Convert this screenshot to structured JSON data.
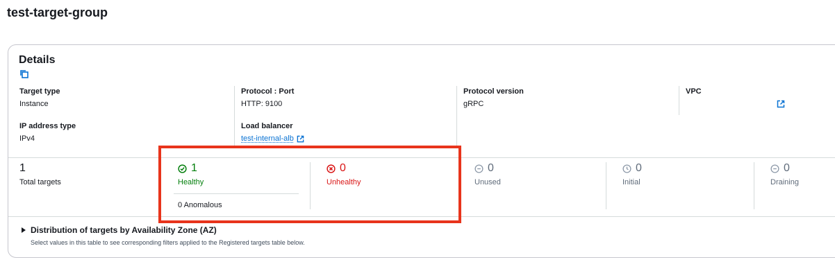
{
  "page": {
    "title": "test-target-group"
  },
  "details": {
    "title": "Details",
    "target_type": {
      "label": "Target type",
      "value": "Instance"
    },
    "protocol_port": {
      "label": "Protocol : Port",
      "value": "HTTP: 9100"
    },
    "protocol_version": {
      "label": "Protocol version",
      "value": "gRPC"
    },
    "vpc": {
      "label": "VPC"
    },
    "ip_address_type": {
      "label": "IP address type",
      "value": "IPv4"
    },
    "load_balancer": {
      "label": "Load balancer",
      "value": "test-internal-alb"
    }
  },
  "stats": {
    "total": {
      "count": "1",
      "label": "Total targets"
    },
    "healthy": {
      "count": "1",
      "label": "Healthy",
      "anomalous": "0 Anomalous"
    },
    "unhealthy": {
      "count": "0",
      "label": "Unhealthy"
    },
    "unused": {
      "count": "0",
      "label": "Unused"
    },
    "initial": {
      "count": "0",
      "label": "Initial"
    },
    "draining": {
      "count": "0",
      "label": "Draining"
    }
  },
  "distribution": {
    "title": "Distribution of targets by Availability Zone (AZ)",
    "description": "Select values in this table to see corresponding filters applied to the Registered targets table below."
  },
  "colors": {
    "link": "#0972d3",
    "healthy": "#037f0c",
    "unhealthy": "#d91515",
    "highlight": "#e8341c"
  }
}
